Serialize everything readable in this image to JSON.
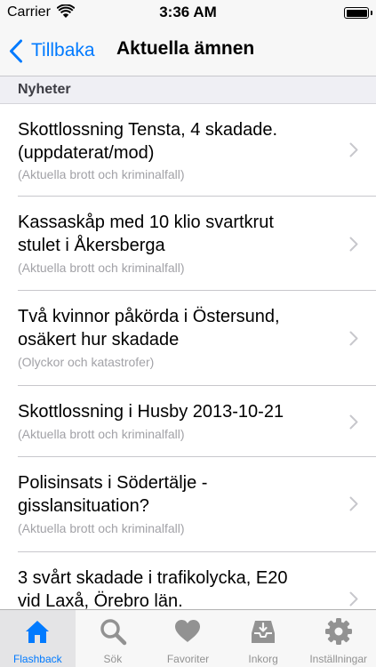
{
  "status_bar": {
    "carrier": "Carrier",
    "time": "3:36 AM"
  },
  "nav": {
    "back_label": "Tillbaka",
    "title": "Aktuella ämnen"
  },
  "section": {
    "title": "Nyheter"
  },
  "items": [
    {
      "title_line1": "Skottlossning Tensta, 4 skadade.",
      "title_line2": "(uppdaterat/mod)",
      "category": "(Aktuella brott och kriminalfall)"
    },
    {
      "title_line1": "Kassaskåp med 10 klio svartkrut",
      "title_line2": "stulet i Åkersberga",
      "category": "(Aktuella brott och kriminalfall)"
    },
    {
      "title_line1": "Två kvinnor påkörda i Östersund,",
      "title_line2": "osäkert hur skadade",
      "category": "(Olyckor och katastrofer)"
    },
    {
      "title_line1": "Skottlossning i Husby 2013-10-21",
      "title_line2": "",
      "category": "(Aktuella brott och kriminalfall)"
    },
    {
      "title_line1": "Polisinsats i Södertälje -",
      "title_line2": "gisslansituation?",
      "category": "(Aktuella brott och kriminalfall)"
    },
    {
      "title_line1": "3 svårt skadade i trafikolycka, E20",
      "title_line2": "vid Laxå, Örebro län.",
      "category": ""
    }
  ],
  "tabs": [
    {
      "label": "Flashback",
      "icon": "home-icon",
      "active": true
    },
    {
      "label": "Sök",
      "icon": "search-icon",
      "active": false
    },
    {
      "label": "Favoriter",
      "icon": "heart-icon",
      "active": false
    },
    {
      "label": "Inkorg",
      "icon": "inbox-icon",
      "active": false
    },
    {
      "label": "Inställningar",
      "icon": "gear-icon",
      "active": false
    }
  ],
  "colors": {
    "accent": "#007aff",
    "inactive_tab": "#929292",
    "subtitle": "#a2a2a7"
  }
}
